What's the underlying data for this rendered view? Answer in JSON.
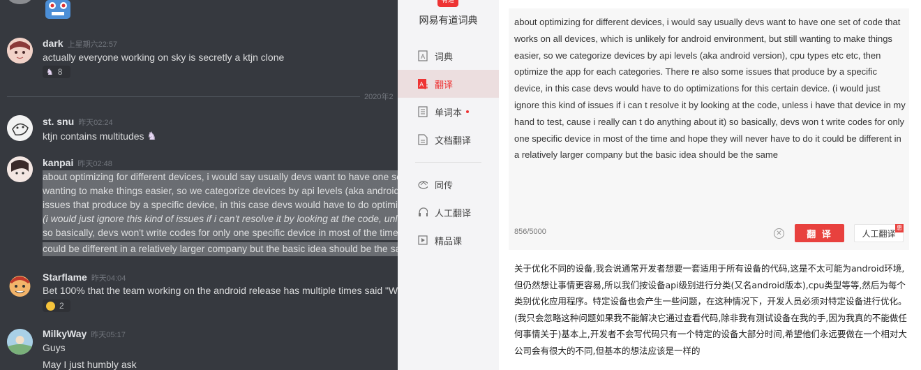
{
  "discord": {
    "top_avatar_icon": "robot-avatar",
    "messages": [
      {
        "user": "dark",
        "time": "上星期六22:57",
        "lines": [
          "actually everyone working on sky is secretly a ktjn clone"
        ],
        "reaction": {
          "icon": "unicorn-emoji",
          "count": "8"
        }
      },
      {
        "user": "st. snu",
        "time": "昨天02:24",
        "lines": [
          "ktjn contains multitudes"
        ],
        "emoji": "unicorn-emoji"
      },
      {
        "user": "kanpai",
        "time": "昨天02:48",
        "lines": [
          "about optimizing for different devices, i would say usually devs want to have one set",
          "wanting to make things easier, so we categorize devices by api levels (aka android ve",
          "issues that produce by a specific device, in this case devs would have to do optimiza",
          "(i would just ignore this kind of issues if i can't resolve it by looking at the code, unle",
          "so basically, devs won't write codes for only one specific device in most of the time a",
          "could be different in a relatively larger company but the basic idea should be the sam"
        ]
      },
      {
        "user": "Starflame",
        "time": "昨天04:04",
        "lines": [
          "Bet 100% that the team working on the android release has multiple times said \"Wh"
        ],
        "reaction": {
          "icon": "grin-emoji",
          "count": "2"
        }
      },
      {
        "user": "MilkyWay",
        "time": "昨天05:17",
        "lines": [
          "Guys",
          "May I just humbly ask"
        ]
      }
    ],
    "date_divider": "2020年2"
  },
  "youdao": {
    "app_title": "网易有道词典",
    "logo_text": "有道",
    "nav": [
      {
        "label": "词典",
        "icon": "dictionary-icon"
      },
      {
        "label": "翻译",
        "icon": "translate-icon"
      },
      {
        "label": "单词本",
        "icon": "wordbook-icon"
      },
      {
        "label": "文档翻译",
        "icon": "document-translate-icon"
      },
      {
        "label": "同传",
        "icon": "simultaneous-interpretation-icon"
      },
      {
        "label": "人工翻译",
        "icon": "human-translation-icon"
      },
      {
        "label": "精品课",
        "icon": "course-icon"
      }
    ],
    "source_text": "about optimizing for different devices, i would say usually devs want to have one set of code that works on all devices, which is unlikely for android environment, but still wanting to make things easier, so we categorize devices by api levels (aka android version), cpu types etc etc, then optimize the app for each categories. There re also some issues that produce by a specific device, in this case devs would have to do optimizations for this certain device. (i would just ignore this kind of issues if i can t resolve it by looking at the code, unless i have that device in my hand to test, cause i really can t do anything about it) so basically, devs won t write codes for only one specific device in most of the time and hope they will never have to do it could be different in a relatively larger company but the basic idea should be the same",
    "char_count": "856/5000",
    "translate_button": "翻 译",
    "human_button": "人工翻译",
    "human_badge": "惠",
    "result_text": "关于优化不同的设备,我会说通常开发者想要一套适用于所有设备的代码,这是不太可能为android环境,但仍然想让事情更容易,所以我们按设备api级别进行分类(又名android版本),cpu类型等等,然后为每个类别优化应用程序。特定设备也会产生一些问题，在这种情况下，开发人员必须对特定设备进行优化。(我只会忽略这种问题如果我不能解决它通过查看代码,除非我有测试设备在我的手,因为我真的不能做任何事情关于)基本上,开发者不会写代码只有一个特定的设备大部分时间,希望他们永远要做在一个相对大公司会有很大的不同,但基本的想法应该是一样的"
  }
}
